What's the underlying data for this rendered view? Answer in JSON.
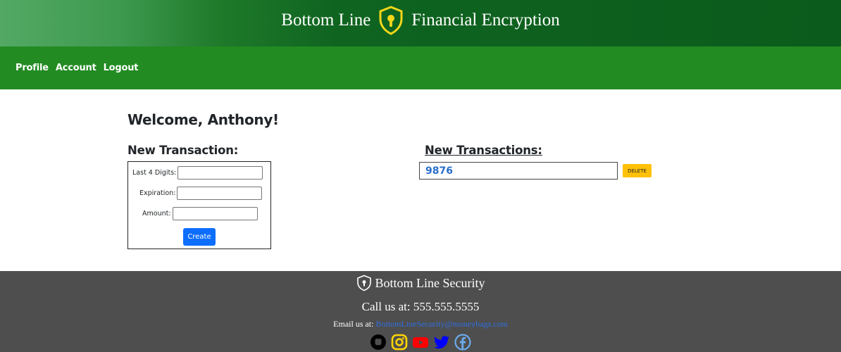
{
  "header": {
    "brand_left": "Bottom Line",
    "brand_right": "Financial Encryption",
    "logo_icon": "shield-keyhole-icon"
  },
  "nav": {
    "items": [
      {
        "label": "Profile"
      },
      {
        "label": "Account"
      },
      {
        "label": "Logout"
      }
    ]
  },
  "main": {
    "welcome": "Welcome, Anthony!",
    "new_transaction_title": "New Transaction:",
    "form": {
      "last4_label": "Last 4 Digits:",
      "last4_value": "",
      "expiration_label": "Expiration:",
      "expiration_value": "",
      "amount_label": "Amount:",
      "amount_value": "",
      "create_label": "Create"
    },
    "transactions_title": "New Transactions:",
    "transactions": [
      {
        "digits": "9876",
        "delete_label": "DELETE"
      }
    ]
  },
  "footer": {
    "brand": "Bottom Line Security",
    "brand_icon": "shield-keyhole-icon",
    "call": "Call us at: 555.555.5555",
    "email_prefix": "Email us at:",
    "email": "BottomLineSecurity@moneybags.com",
    "socials": [
      {
        "name": "github-icon",
        "color": "#000000"
      },
      {
        "name": "instagram-icon",
        "color": "#ffd400"
      },
      {
        "name": "youtube-icon",
        "color": "#ff0000"
      },
      {
        "name": "twitter-icon",
        "color": "#0000ff"
      },
      {
        "name": "facebook-icon",
        "color": "#6aa9e9"
      }
    ]
  },
  "colors": {
    "nav_bg": "#228b22",
    "banner_dark": "#0b5b1c",
    "primary_button": "#0d6efd",
    "warning_button": "#ffc107",
    "footer_bg": "#4e4e4e"
  }
}
